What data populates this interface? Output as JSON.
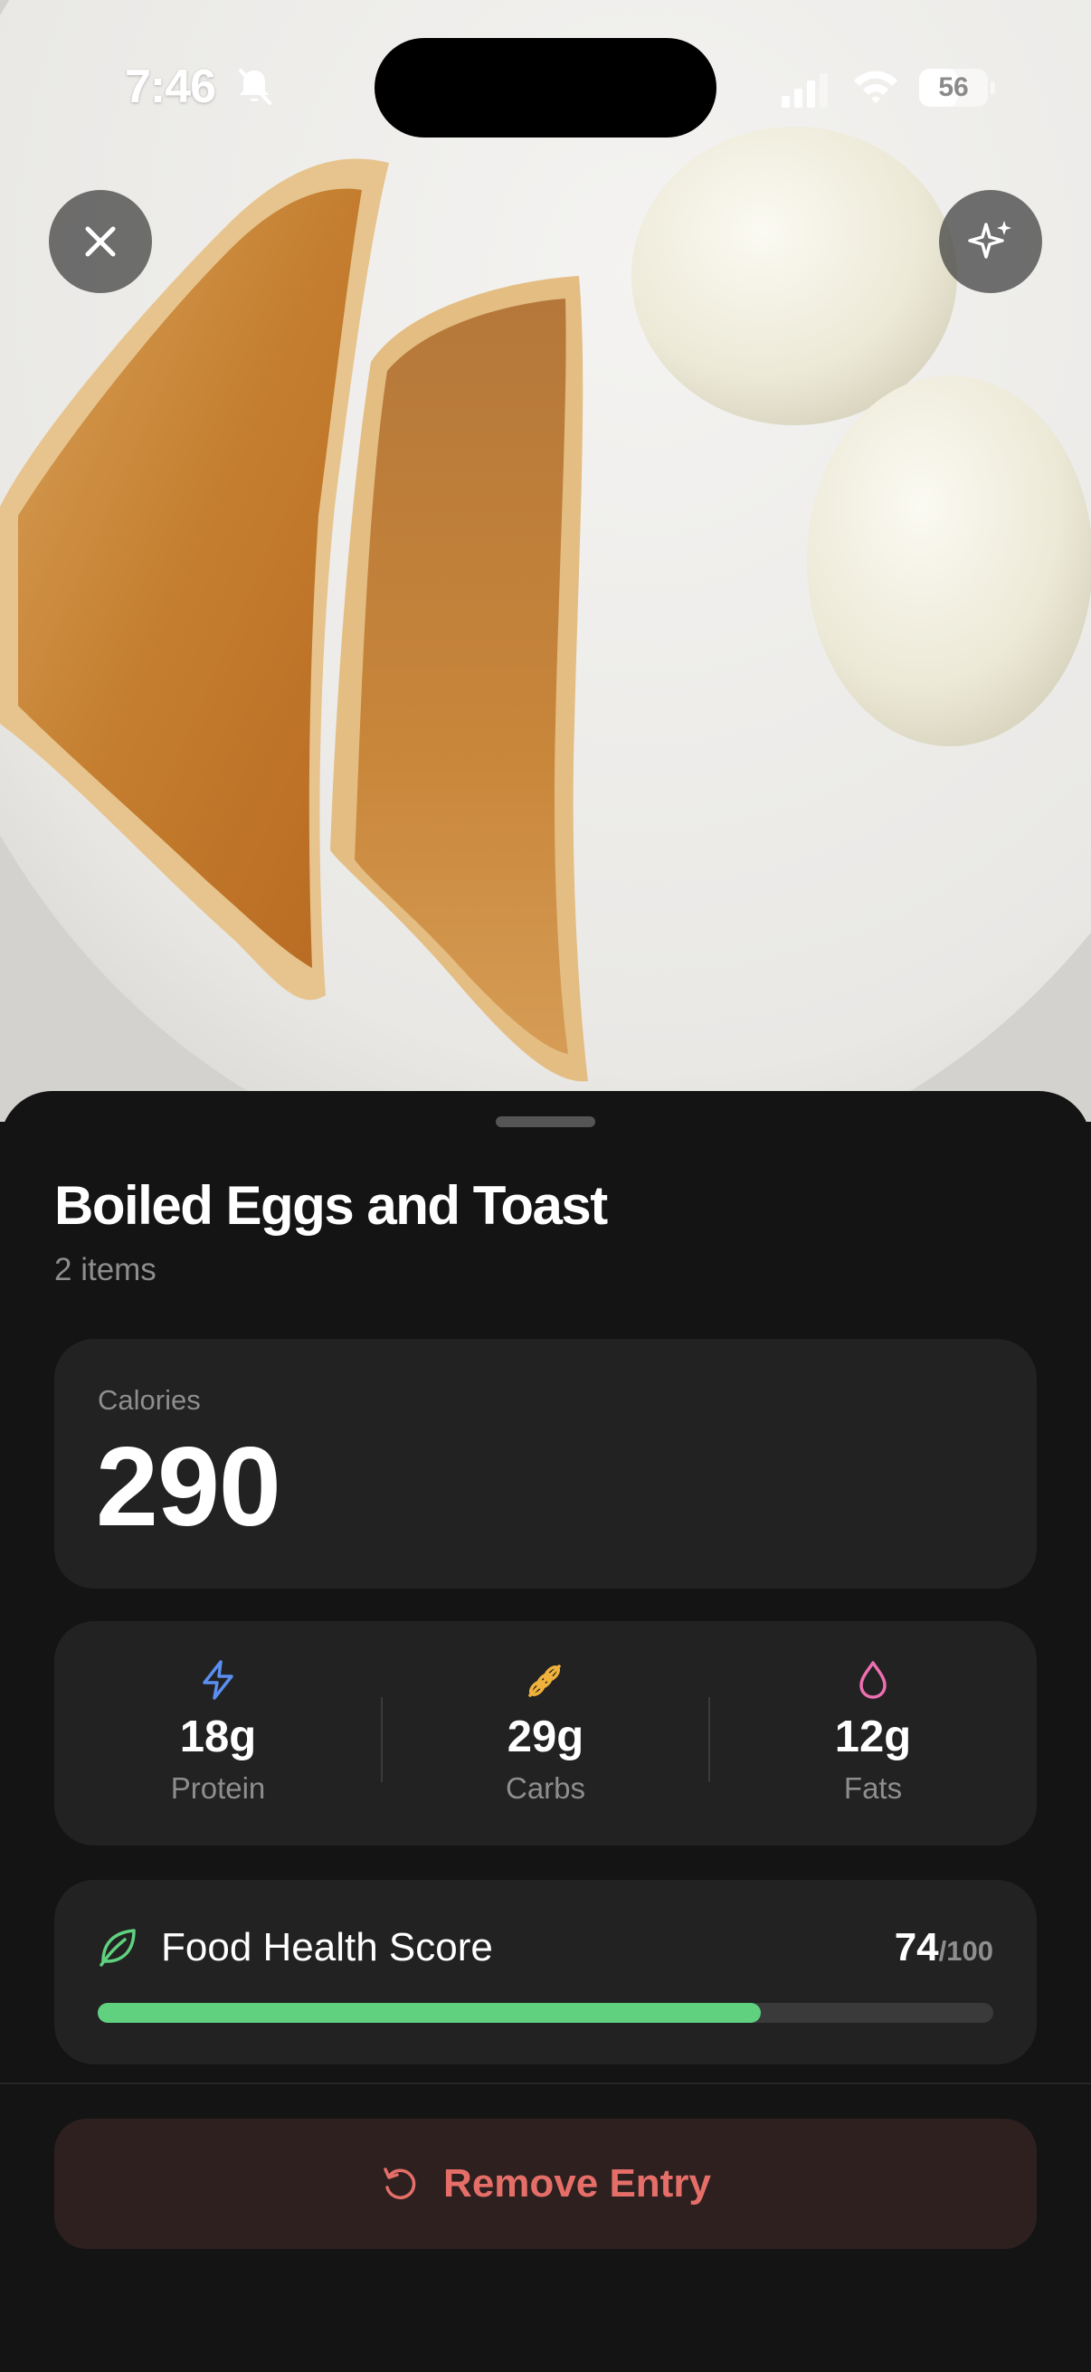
{
  "status_bar": {
    "time": "7:46",
    "battery_level": "56",
    "battery_fraction": 0.56
  },
  "header_buttons": {
    "close_icon": "close-icon",
    "ai_icon": "sparkles-icon"
  },
  "meal": {
    "title": "Boiled Eggs and Toast",
    "item_count": "2 items"
  },
  "calories": {
    "label": "Calories",
    "value": "290"
  },
  "macros": [
    {
      "key": "protein",
      "value": "18g",
      "label": "Protein",
      "icon": "lightning-icon",
      "color": "#5a8ef0"
    },
    {
      "key": "carbs",
      "value": "29g",
      "label": "Carbs",
      "icon": "wheat-icon",
      "color": "#f0b23c"
    },
    {
      "key": "fats",
      "value": "12g",
      "label": "Fats",
      "icon": "droplet-icon",
      "color": "#ef6fb0"
    }
  ],
  "health_score": {
    "label": "Food Health Score",
    "value": "74",
    "max": "/100",
    "fraction": 0.74,
    "color": "#5fd17f"
  },
  "actions": {
    "remove_label": "Remove Entry",
    "remove_color": "#e56f68"
  }
}
